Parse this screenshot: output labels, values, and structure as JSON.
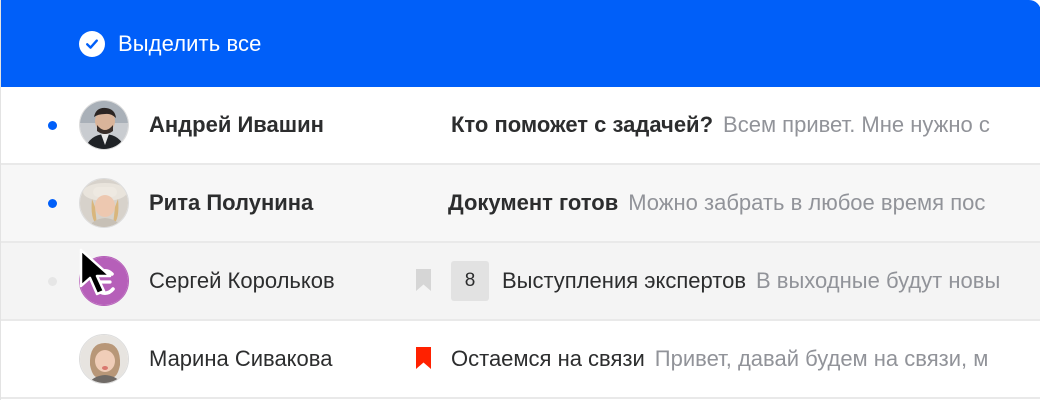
{
  "toolbar": {
    "select_all_label": "Выделить все",
    "check_icon": "check-circle-icon",
    "background": "#005ff9"
  },
  "colors": {
    "accent": "#005ff9",
    "unread_dot": "#005ff9",
    "flag_active": "#ff2100",
    "flag_inactive": "#d6d6d6",
    "snippet": "#919399"
  },
  "messages": [
    {
      "sender": "Андрей Ивашин",
      "unread": true,
      "subject": "Кто поможет с задачей?",
      "snippet": "Всем привет. Мне нужно с",
      "avatar_icon": "avatar-man-icon"
    },
    {
      "sender": "Рита Полунина",
      "unread": true,
      "subject": "Документ готов",
      "snippet": "Можно забрать в любое время пос",
      "avatar_icon": "avatar-woman-hat-icon"
    },
    {
      "sender": "Сергей Корольков",
      "unread": false,
      "flag": "inactive",
      "thread_count": "8",
      "subject": "Выступления экспертов",
      "snippet": "В выходные будут новы",
      "avatar_icon": "avatar-letter-icon"
    },
    {
      "sender": "Марина Сивакова",
      "unread": false,
      "flag": "active",
      "subject": "Остаемся на связи",
      "snippet": "Привет, давай будем на связи, м",
      "avatar_icon": "avatar-woman-icon"
    }
  ]
}
